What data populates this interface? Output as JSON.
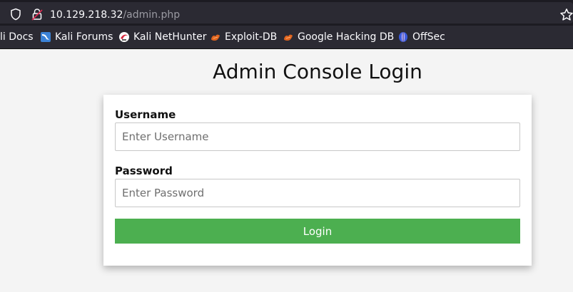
{
  "browser": {
    "url_host": "10.129.218.32",
    "url_path": "/admin.php",
    "icons": {
      "left": [
        "shield-icon",
        "lock-icon"
      ],
      "right": [
        "star-icon"
      ]
    },
    "bookmarks": [
      {
        "label": "li Docs",
        "icon": "none"
      },
      {
        "label": "Kali Forums",
        "icon": "kali-forums-icon"
      },
      {
        "label": "Kali NetHunter",
        "icon": "kali-nethunter-icon"
      },
      {
        "label": "Exploit-DB",
        "icon": "exploit-db-icon"
      },
      {
        "label": "Google Hacking DB",
        "icon": "google-hacking-db-icon"
      },
      {
        "label": "OffSec",
        "icon": "offsec-icon"
      }
    ]
  },
  "page": {
    "title": "Admin Console Login",
    "form": {
      "username_label": "Username",
      "username_placeholder": "Enter Username",
      "username_value": "",
      "password_label": "Password",
      "password_placeholder": "Enter Password",
      "password_value": "",
      "login_label": "Login"
    }
  },
  "colors": {
    "toolbar_bg": "#2b2a33",
    "page_bg": "#f4f4f4",
    "button_green": "#4caf50"
  }
}
